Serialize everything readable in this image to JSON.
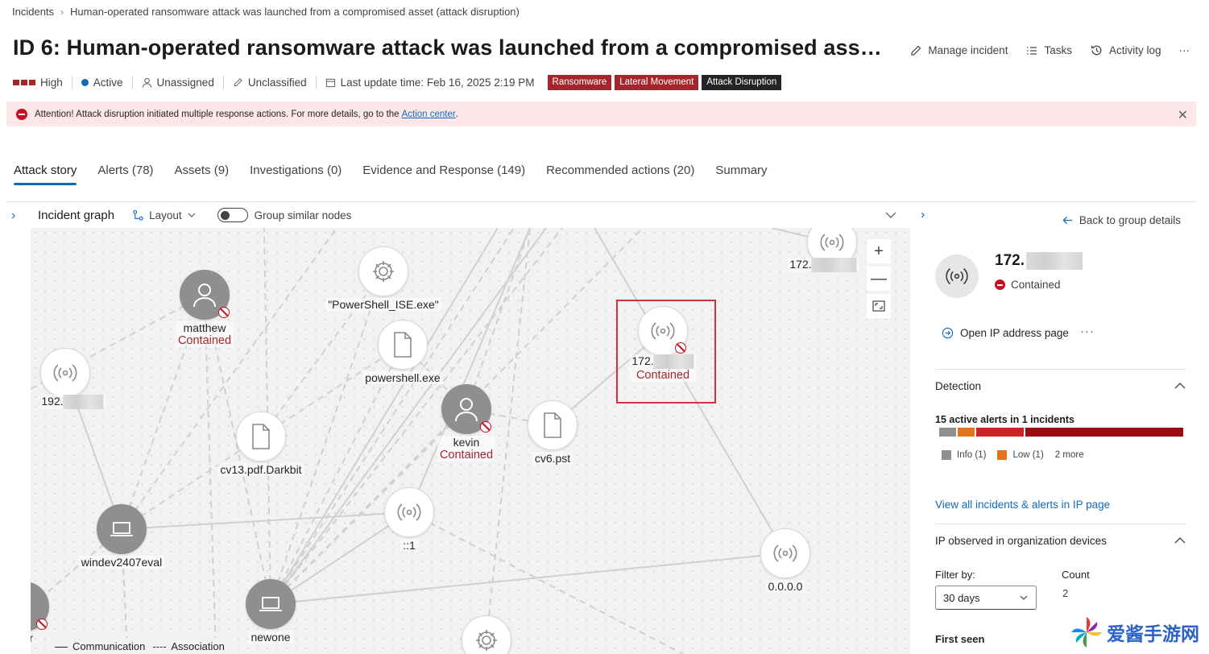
{
  "breadcrumb": {
    "root": "Incidents",
    "current": "Human-operated ransomware attack was launched from a compromised asset (attack disruption)"
  },
  "title": "ID 6: Human-operated ransomware attack was launched from a compromised asse…",
  "title_actions": {
    "manage": "Manage incident",
    "tasks": "Tasks",
    "activity": "Activity log",
    "more": "···"
  },
  "meta": {
    "severity": "High",
    "status": "Active",
    "assigned": "Unassigned",
    "classification": "Unclassified",
    "last_update": "Last update time: Feb 16, 2025 2:19 PM",
    "tags": [
      "Ransomware",
      "Lateral Movement",
      "Attack Disruption"
    ]
  },
  "banner": {
    "text": "Attention! Attack disruption initiated multiple response actions. For more details, go to the",
    "link": "Action center",
    "suffix": "."
  },
  "tabs": [
    "Attack story",
    "Alerts (78)",
    "Assets (9)",
    "Investigations (0)",
    "Evidence and Response (149)",
    "Recommended actions (20)",
    "Summary"
  ],
  "graph": {
    "title": "Incident graph",
    "layout_label": "Layout",
    "group_toggle_label": "Group similar nodes",
    "group_toggle_on": false,
    "nodes": {
      "matthew": {
        "label": "matthew",
        "status": "Contained"
      },
      "kevin": {
        "label": "kevin",
        "status": "Contained"
      },
      "powershell_ise": {
        "label": "\"PowerShell_ISE.exe\""
      },
      "powershell": {
        "label": "powershell.exe"
      },
      "ip_172_top": {
        "label": "172."
      },
      "ip_172_sel": {
        "label": "172.",
        "status": "Contained"
      },
      "ip_192": {
        "label": "192."
      },
      "cv13": {
        "label": "cv13.pdf.Darkbit"
      },
      "cv6": {
        "label": "cv6.pst"
      },
      "ipv6": {
        "label": "::1"
      },
      "windev": {
        "label": "windev2407eval"
      },
      "newone": {
        "label": "newone"
      },
      "zeros": {
        "label": "0.0.0.0"
      },
      "ator": {
        "label": "ator"
      }
    },
    "legend": {
      "communication": "Communication",
      "association": "Association"
    },
    "zoom": {
      "in": "+",
      "out": "—"
    }
  },
  "panel": {
    "back_label": "Back to group details",
    "ip_prefix": "172.",
    "status": "Contained",
    "open_ip": "Open IP address page",
    "more": "···",
    "detection": {
      "heading": "Detection",
      "summary": "15 active alerts in 1 incidents",
      "segments": [
        {
          "color": "#8f8f8f",
          "share": 0.07
        },
        {
          "color": "#e3731d",
          "share": 0.07
        },
        {
          "color": "#d21f25",
          "share": 0.2
        },
        {
          "color": "#9c0a10",
          "share": 0.66
        }
      ],
      "legend": [
        {
          "label": "Info (1)",
          "color": "#8f8f8f"
        },
        {
          "label": "Low (1)",
          "color": "#e3731d"
        }
      ],
      "more": "2 more"
    },
    "view_all": "View all incidents & alerts in IP page",
    "observed": {
      "heading": "IP observed in organization devices",
      "filter_label": "Filter by:",
      "filter_value": "30 days",
      "count_label": "Count",
      "count_value": "2",
      "first_seen": "First seen"
    }
  },
  "watermark": "爱酱手游网"
}
